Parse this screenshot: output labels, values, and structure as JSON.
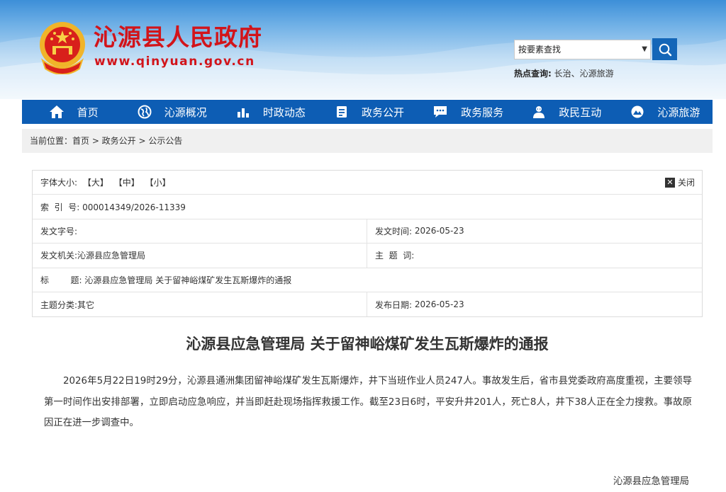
{
  "header": {
    "site_title": "沁源县人民政府",
    "site_url": "www.qinyuan.gov.cn",
    "search_select_value": "按要素查找",
    "hot_search_label": "热点查询:",
    "hot_search_items": "长治、沁源旅游",
    "colors": {
      "brand_red": "#d2141a",
      "nav_blue": "#0d5db4"
    }
  },
  "nav": {
    "items": [
      {
        "label": "首页",
        "icon": "home-icon"
      },
      {
        "label": "沁源概况",
        "icon": "globe-icon"
      },
      {
        "label": "时政动态",
        "icon": "bar-chart-icon"
      },
      {
        "label": "政务公开",
        "icon": "document-icon"
      },
      {
        "label": "政务服务",
        "icon": "chat-icon"
      },
      {
        "label": "政民互动",
        "icon": "people-icon"
      },
      {
        "label": "沁源旅游",
        "icon": "tourism-icon"
      }
    ]
  },
  "breadcrumb": {
    "text": "当前位置：首页 > 政务公开 > 公示公告"
  },
  "meta": {
    "font_size_label": "字体大小:",
    "font_large": "【大】",
    "font_medium": "【中】",
    "font_small": "【小】",
    "close_label": "关闭",
    "index_label": "索  引  号:",
    "index_value": "000014349/2026-11339",
    "doc_no_label": "发文字号:",
    "doc_no_value": "",
    "issue_time_label": "发文时间:",
    "issue_time_value": "2026-05-23",
    "issuer_label": "发文机关:",
    "issuer_value": "沁源县应急管理局",
    "keywords_label": "主  题  词:",
    "keywords_value": "",
    "title_label": "标        题:",
    "title_value": "沁源县应急管理局 关于留神峪煤矿发生瓦斯爆炸的通报",
    "category_label": "主题分类:",
    "category_value": "其它",
    "publish_date_label": "发布日期:",
    "publish_date_value": "2026-05-23"
  },
  "article": {
    "title": "沁源县应急管理局 关于留神峪煤矿发生瓦斯爆炸的通报",
    "body": "2026年5月22日19时29分，沁源县通洲集团留神峪煤矿发生瓦斯爆炸，井下当班作业人员247人。事故发生后，省市县党委政府高度重视，主要领导第一时间作出安排部署，立即启动应急响应，并当即赶赴现场指挥救援工作。截至23日6时，平安升井201人，死亡8人，井下38人正在全力搜救。事故原因正在进一步调查中。",
    "signature": "沁源县应急管理局"
  }
}
